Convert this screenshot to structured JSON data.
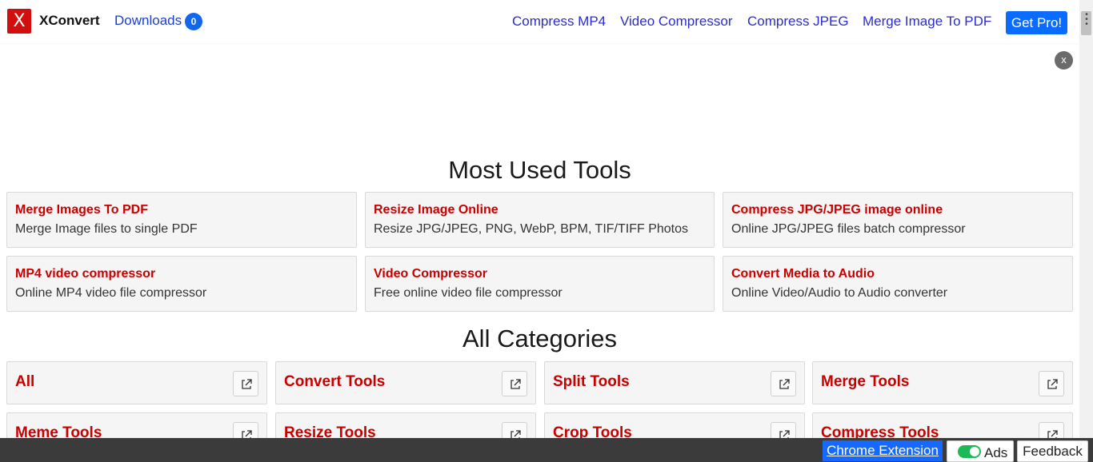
{
  "header": {
    "logo_letter": "X",
    "brand": "XConvert",
    "downloads_label": "Downloads",
    "downloads_count": "0",
    "nav": [
      "Compress MP4",
      "Video Compressor",
      "Compress JPEG",
      "Merge Image To PDF"
    ],
    "get_pro_label": "Get Pro!"
  },
  "ad": {
    "close_label": "x"
  },
  "most_used": {
    "title": "Most Used Tools",
    "tools": [
      {
        "title": "Merge Images To PDF",
        "desc": "Merge Image files to single PDF"
      },
      {
        "title": "Resize Image Online",
        "desc": "Resize JPG/JPEG, PNG, WebP, BPM, TIF/TIFF Photos"
      },
      {
        "title": "Compress JPG/JPEG image online",
        "desc": "Online JPG/JPEG files batch compressor"
      },
      {
        "title": "MP4 video compressor",
        "desc": "Online MP4 video file compressor"
      },
      {
        "title": "Video Compressor",
        "desc": "Free online video file compressor"
      },
      {
        "title": "Convert Media to Audio",
        "desc": "Online Video/Audio to Audio converter"
      }
    ]
  },
  "categories": {
    "title": "All Categories",
    "items": [
      "All",
      "Convert Tools",
      "Split Tools",
      "Merge Tools",
      "Meme Tools",
      "Resize Tools",
      "Crop Tools",
      "Compress Tools"
    ]
  },
  "footer": {
    "chrome_extension_label": "Chrome Extension",
    "ads_label": "Ads",
    "ads_enabled": true,
    "feedback_label": "Feedback"
  },
  "colors": {
    "brand_red": "#d20f0f",
    "tool_title": "#c80000",
    "nav_link": "#2b2bd1",
    "primary_button": "#0a6cff",
    "toggle_on": "#1db954"
  }
}
